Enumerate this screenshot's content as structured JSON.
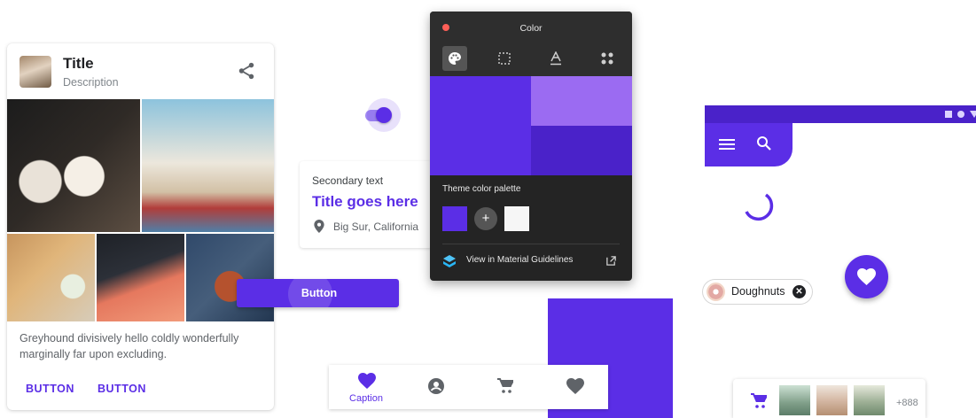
{
  "card": {
    "title": "Title",
    "description": "Description",
    "body": "Greyhound divisively hello coldly wonderfully marginally far upon excluding.",
    "button1": "BUTTON",
    "button2": "BUTTON"
  },
  "text_card": {
    "secondary": "Secondary text",
    "title": "Title goes here",
    "location": "Big Sur, California"
  },
  "button": {
    "label": "Button"
  },
  "color_panel": {
    "title": "Color",
    "tabs": [
      "palette-icon",
      "shape-icon",
      "typography-icon",
      "components-icon"
    ],
    "palette_label": "Theme color palette",
    "link": "View in Material Guidelines",
    "colors": {
      "primary": "#5b2ee6",
      "light": "#9b6bf2",
      "dark": "#4a22c9",
      "surface": "#f6f6f6"
    }
  },
  "switch": {
    "on": true
  },
  "bottom_nav": {
    "items": [
      {
        "icon": "heart-icon",
        "caption": "Caption",
        "active": true
      },
      {
        "icon": "account-icon"
      },
      {
        "icon": "cart-icon"
      },
      {
        "icon": "heart-icon"
      }
    ]
  },
  "chip": {
    "label": "Doughnuts"
  },
  "image_list": {
    "more": "+888"
  },
  "accent": "#5b2ee6"
}
